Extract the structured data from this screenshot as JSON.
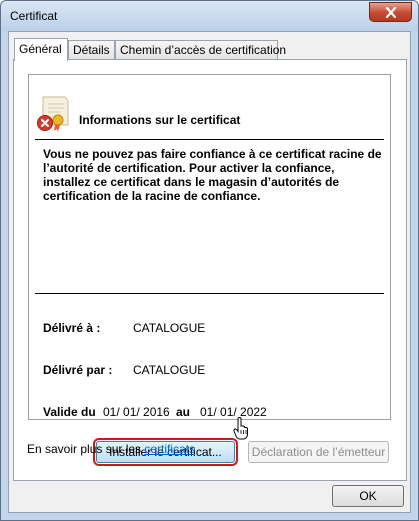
{
  "window": {
    "title": "Certificat",
    "close_icon": "close-icon"
  },
  "tabs": [
    {
      "label": "Général",
      "active": true
    },
    {
      "label": "Détails",
      "active": false
    },
    {
      "label": "Chemin d’accès de certification",
      "active": false
    }
  ],
  "certificate": {
    "icon": "certificate-error-icon",
    "heading": "Informations sur le certificat",
    "message": "Vous ne pouvez pas faire confiance à ce certificat racine de l’autorité de certification. Pour activer la confiance, installez ce certificat dans le magasin d’autorités de certification de la racine de confiance.",
    "issued_to_label": "Délivré à :",
    "issued_to_value": "CATALOGUE",
    "issued_by_label": "Délivré par :",
    "issued_by_value": "CATALOGUE",
    "valid_from_label": "Valide du",
    "valid_from_value": "01/ 01/ 2016",
    "valid_to_label": "au",
    "valid_to_value": "01/ 01/ 2022"
  },
  "buttons": {
    "install": "Installer le certificat...",
    "issuer_statement": "Déclaration de l’émetteur",
    "ok": "OK"
  },
  "learn_more": {
    "prefix": "En savoir plus sur les",
    "link": "certificats"
  },
  "colors": {
    "title_bar": "#c3d5ea",
    "close_button": "#c74a32",
    "link": "#0066cc",
    "focus_ring": "#cc1a1a"
  }
}
